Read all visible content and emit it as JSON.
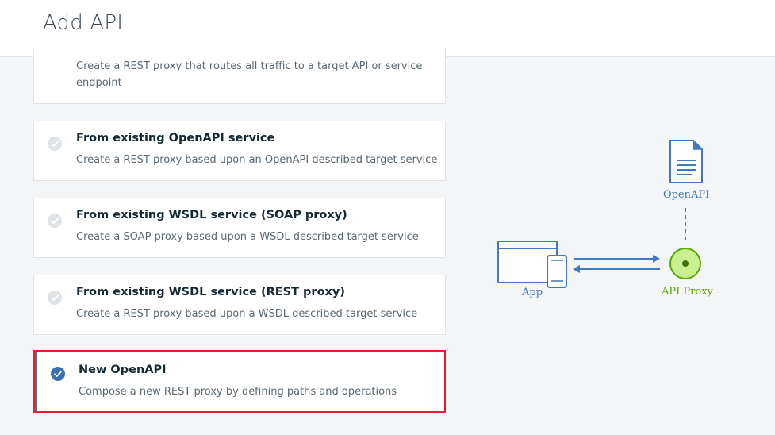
{
  "header": {
    "title": "Add API"
  },
  "options": [
    {
      "title": "",
      "description": "Create a REST proxy that routes all traffic to a target API or service endpoint",
      "selected": false
    },
    {
      "title": "From existing OpenAPI service",
      "description": "Create a REST proxy based upon an OpenAPI described target service",
      "selected": false
    },
    {
      "title": "From existing WSDL service (SOAP proxy)",
      "description": "Create a SOAP proxy based upon a WSDL described target service",
      "selected": false
    },
    {
      "title": "From existing WSDL service (REST proxy)",
      "description": "Create a REST proxy based upon a WSDL described target service",
      "selected": false
    },
    {
      "title": "New OpenAPI",
      "description": "Compose a new REST proxy by defining paths and operations",
      "selected": true
    }
  ],
  "diagram": {
    "openapi_label": "OpenAPI",
    "app_label": "App",
    "proxy_label": "API Proxy",
    "icons": [
      "document-icon",
      "app-window-icon",
      "mobile-icon",
      "proxy-node-icon"
    ],
    "colors": {
      "app": "#4178be",
      "proxy": "#5aa700",
      "proxy_fill": "#c8f08f",
      "check_selected": "#3d70b2"
    }
  }
}
